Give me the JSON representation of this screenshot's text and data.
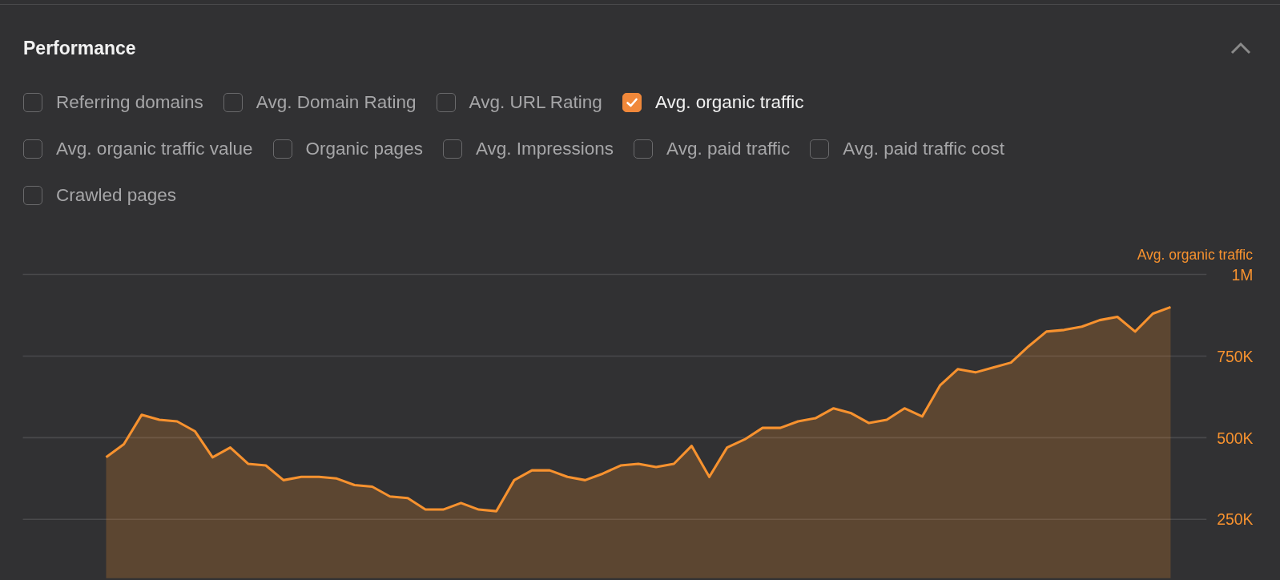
{
  "panel": {
    "title": "Performance",
    "collapsible": true
  },
  "metric_rows": [
    {
      "items": [
        {
          "label": "Referring domains",
          "checked": false
        },
        {
          "label": "Avg. Domain Rating",
          "checked": false
        },
        {
          "label": "Avg. URL Rating",
          "checked": false
        },
        {
          "label": "Avg. organic traffic",
          "checked": true
        }
      ]
    },
    {
      "items": [
        {
          "label": "Avg. organic traffic value",
          "checked": false
        },
        {
          "label": "Organic pages",
          "checked": false
        },
        {
          "label": "Avg. Impressions",
          "checked": false
        },
        {
          "label": "Avg. paid traffic",
          "checked": false
        },
        {
          "label": "Avg. paid traffic cost",
          "checked": false
        }
      ]
    },
    {
      "items": [
        {
          "label": "Crawled pages",
          "checked": false
        }
      ]
    }
  ],
  "chart": {
    "chart_data": {
      "type": "area",
      "ylim": [
        0,
        1000000
      ],
      "grid": true,
      "yticks": [
        {
          "value": 250000,
          "label": "250K"
        },
        {
          "value": 500000,
          "label": "500K"
        },
        {
          "value": 750000,
          "label": "750K"
        },
        {
          "value": 1000000,
          "label": "1M"
        }
      ],
      "series": [
        {
          "name": "Avg. organic traffic",
          "color": "#f7922f",
          "values": [
            440000,
            480000,
            570000,
            555000,
            550000,
            520000,
            440000,
            470000,
            420000,
            415000,
            370000,
            380000,
            380000,
            375000,
            355000,
            350000,
            320000,
            315000,
            280000,
            280000,
            300000,
            280000,
            275000,
            370000,
            400000,
            400000,
            380000,
            370000,
            390000,
            415000,
            420000,
            410000,
            420000,
            475000,
            380000,
            470000,
            495000,
            530000,
            530000,
            550000,
            560000,
            590000,
            575000,
            545000,
            555000,
            590000,
            565000,
            660000,
            710000,
            700000,
            715000,
            730000,
            780000,
            825000,
            830000,
            840000,
            860000,
            870000,
            825000,
            880000,
            900000
          ]
        }
      ]
    }
  }
}
